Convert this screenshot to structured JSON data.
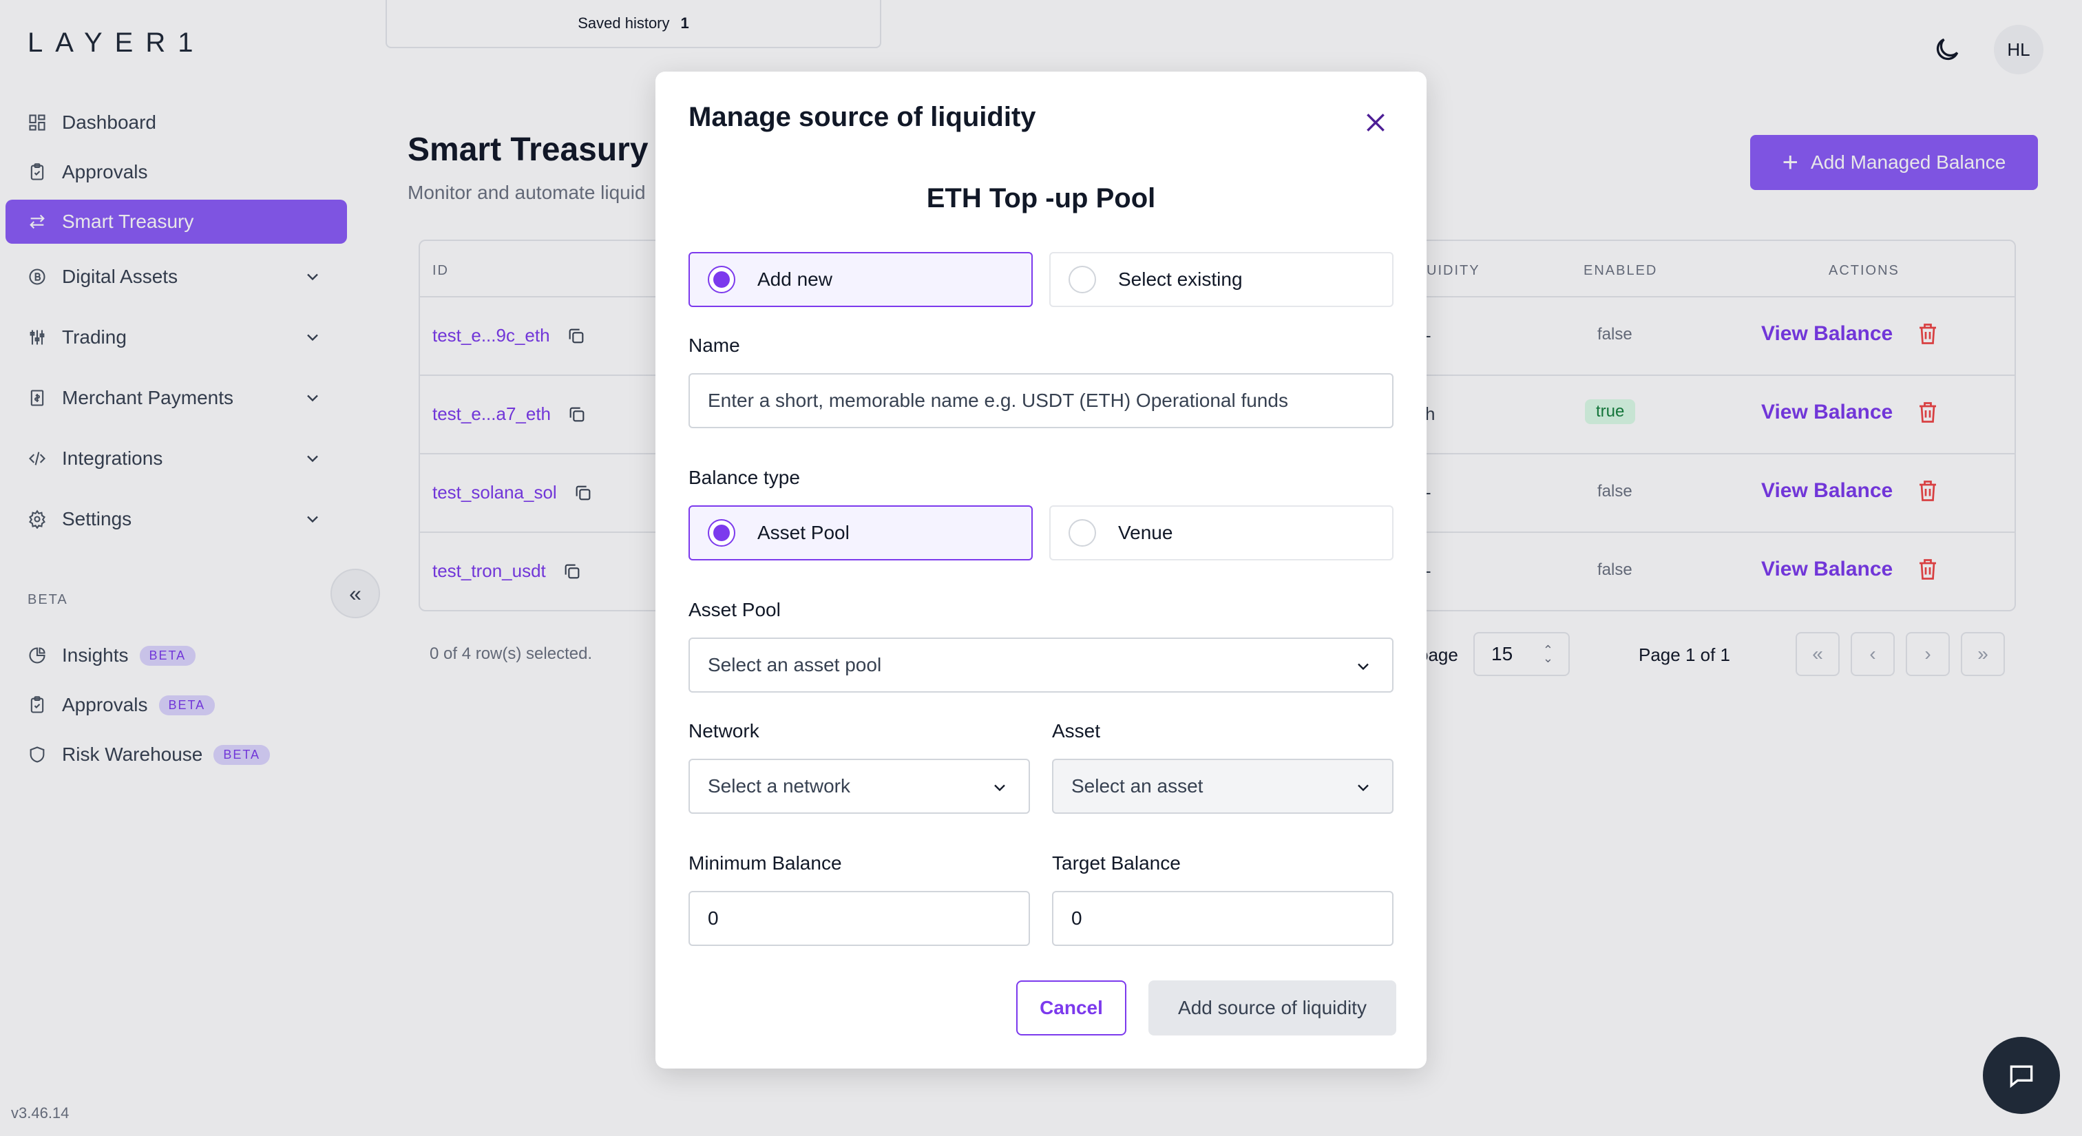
{
  "app": {
    "logo": "LAYER1",
    "version": "v3.46.14"
  },
  "sidebar": {
    "items": [
      {
        "label": "Dashboard",
        "icon": "dashboard-icon"
      },
      {
        "label": "Approvals",
        "icon": "clipboard-check-icon"
      },
      {
        "label": "Smart Treasury",
        "icon": "arrows-swap-icon",
        "active": true
      },
      {
        "label": "Digital Assets",
        "icon": "coin-icon",
        "expandable": true
      },
      {
        "label": "Trading",
        "icon": "sliders-icon",
        "expandable": true
      },
      {
        "label": "Merchant Payments",
        "icon": "receipt-icon",
        "expandable": true
      },
      {
        "label": "Integrations",
        "icon": "code-icon",
        "expandable": true
      },
      {
        "label": "Settings",
        "icon": "gear-icon",
        "expandable": true
      }
    ],
    "beta_section_label": "BETA",
    "beta_items": [
      {
        "label": "Insights",
        "badge": "BETA",
        "icon": "pie-chart-icon"
      },
      {
        "label": "Approvals",
        "badge": "BETA",
        "icon": "clipboard-check-icon"
      },
      {
        "label": "Risk Warehouse",
        "badge": "BETA",
        "icon": "shield-icon"
      }
    ]
  },
  "saved_history": {
    "label": "Saved history",
    "count": "1"
  },
  "header": {
    "avatar_initials": "HL"
  },
  "page": {
    "title": "Smart Treasury",
    "subtitle": "Monitor and automate liquid",
    "add_button": "Add Managed Balance"
  },
  "table": {
    "headers": {
      "id": "ID",
      "liquidity": "UIDITY",
      "enabled": "ENABLED",
      "actions": "ACTIONS"
    },
    "rows": [
      {
        "id": "test_e...9c_eth",
        "partial": "-",
        "enabled": "false",
        "action": "View Balance"
      },
      {
        "id": "test_e...a7_eth",
        "partial": "h",
        "enabled": "true",
        "action": "View Balance"
      },
      {
        "id": "test_solana_sol",
        "partial": "-",
        "enabled": "false",
        "action": "View Balance"
      },
      {
        "id": "test_tron_usdt",
        "partial": "-",
        "enabled": "false",
        "action": "View Balance"
      }
    ],
    "selected_count": "0 of 4 row(s) selected.",
    "per_page_label": "page",
    "per_page_value": "15",
    "page_of": "Page 1 of 1"
  },
  "modal": {
    "title": "Manage source of liquidity",
    "subtitle": "ETH Top -up Pool",
    "mode_options": {
      "add_new": "Add new",
      "select_existing": "Select existing"
    },
    "mode_selected": "add_new",
    "name_label": "Name",
    "name_placeholder": "Enter a short, memorable name e.g. USDT (ETH) Operational funds",
    "balance_type_label": "Balance type",
    "balance_type_options": {
      "asset_pool": "Asset Pool",
      "venue": "Venue"
    },
    "balance_type_selected": "asset_pool",
    "asset_pool_label": "Asset Pool",
    "asset_pool_placeholder": "Select an asset pool",
    "network_label": "Network",
    "network_placeholder": "Select a network",
    "asset_label": "Asset",
    "asset_placeholder": "Select an asset",
    "min_balance_label": "Minimum Balance",
    "min_balance_value": "0",
    "target_balance_label": "Target Balance",
    "target_balance_value": "0",
    "cancel_label": "Cancel",
    "submit_label": "Add source of liquidity"
  },
  "colors": {
    "accent": "#8b5cf6",
    "accent_dark": "#7c3aed",
    "danger": "#ef4444",
    "success_bg": "#dcfce7",
    "success_text": "#15803d"
  }
}
